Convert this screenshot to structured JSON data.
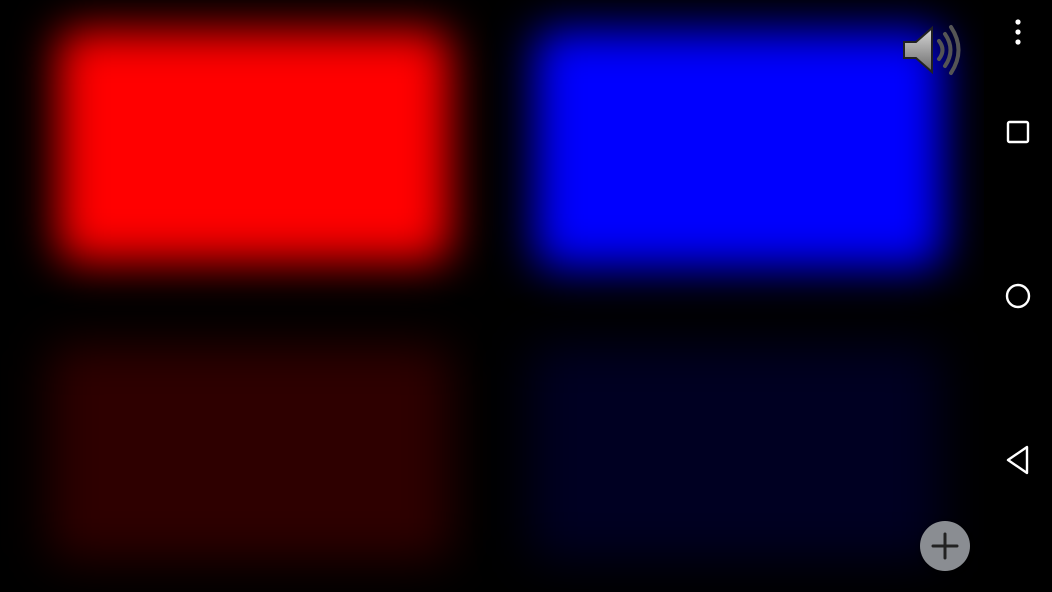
{
  "app": {
    "panels": [
      {
        "id": "red-top",
        "color": "#ff0000",
        "state": "on"
      },
      {
        "id": "blue-top",
        "color": "#0000ff",
        "state": "on"
      },
      {
        "id": "red-bottom",
        "color": "#2e0000",
        "state": "dim"
      },
      {
        "id": "blue-bottom",
        "color": "#000022",
        "state": "dim"
      }
    ],
    "controls": {
      "sound_icon": "speaker-volume-icon",
      "add_icon": "plus-icon"
    }
  },
  "navbar": {
    "items": [
      {
        "icon": "overflow-menu-icon"
      },
      {
        "icon": "recents-square-icon"
      },
      {
        "icon": "home-circle-icon"
      },
      {
        "icon": "back-triangle-icon"
      }
    ]
  }
}
